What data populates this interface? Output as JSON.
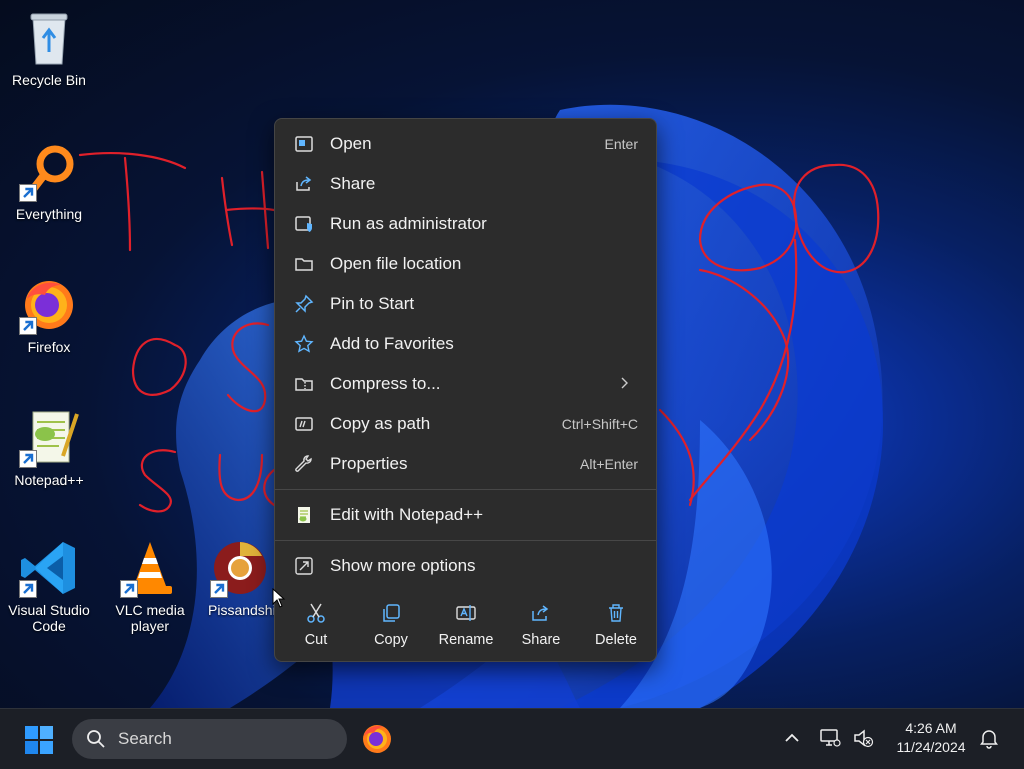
{
  "desktop": {
    "icons": [
      {
        "label": "Recycle Bin",
        "icon": "recycle-bin-icon"
      },
      {
        "label": "Everything",
        "icon": "everything-search-icon"
      },
      {
        "label": "Firefox",
        "icon": "firefox-icon"
      },
      {
        "label": "Notepad++",
        "icon": "notepadpp-icon"
      },
      {
        "label": "Visual Studio Code",
        "icon": "vscode-icon"
      },
      {
        "label": "VLC media player",
        "icon": "vlc-icon"
      },
      {
        "label": "Pissandshi",
        "icon": "chrome-icon"
      }
    ],
    "scribble_color": "#e0202a"
  },
  "context_menu": {
    "items": [
      {
        "label": "Open",
        "shortcut": "Enter",
        "icon": "open-window-icon"
      },
      {
        "label": "Share",
        "shortcut": "",
        "icon": "share-icon"
      },
      {
        "label": "Run as administrator",
        "shortcut": "",
        "icon": "shield-admin-icon"
      },
      {
        "label": "Open file location",
        "shortcut": "",
        "icon": "folder-icon"
      },
      {
        "label": "Pin to Start",
        "shortcut": "",
        "icon": "pin-icon"
      },
      {
        "label": "Add to Favorites",
        "shortcut": "",
        "icon": "star-icon"
      },
      {
        "label": "Compress to...",
        "shortcut": "",
        "icon": "zip-folder-icon"
      },
      {
        "label": "Copy as path",
        "shortcut": "Ctrl+Shift+C",
        "icon": "copy-path-icon"
      },
      {
        "label": "Properties",
        "shortcut": "Alt+Enter",
        "icon": "wrench-icon"
      },
      {
        "label": "Edit with Notepad++",
        "shortcut": "",
        "icon": "notepadpp-icon"
      },
      {
        "label": "Show more options",
        "shortcut": "",
        "icon": "more-options-icon"
      }
    ],
    "quick_actions": [
      {
        "label": "Cut",
        "icon": "scissors-icon"
      },
      {
        "label": "Copy",
        "icon": "copy-icon"
      },
      {
        "label": "Rename",
        "icon": "rename-icon"
      },
      {
        "label": "Share",
        "icon": "share-icon"
      },
      {
        "label": "Delete",
        "icon": "trash-icon"
      }
    ],
    "accent": "#60b6ff"
  },
  "taskbar": {
    "search_label": "Search",
    "time": "4:26 AM",
    "date": "11/24/2024"
  }
}
